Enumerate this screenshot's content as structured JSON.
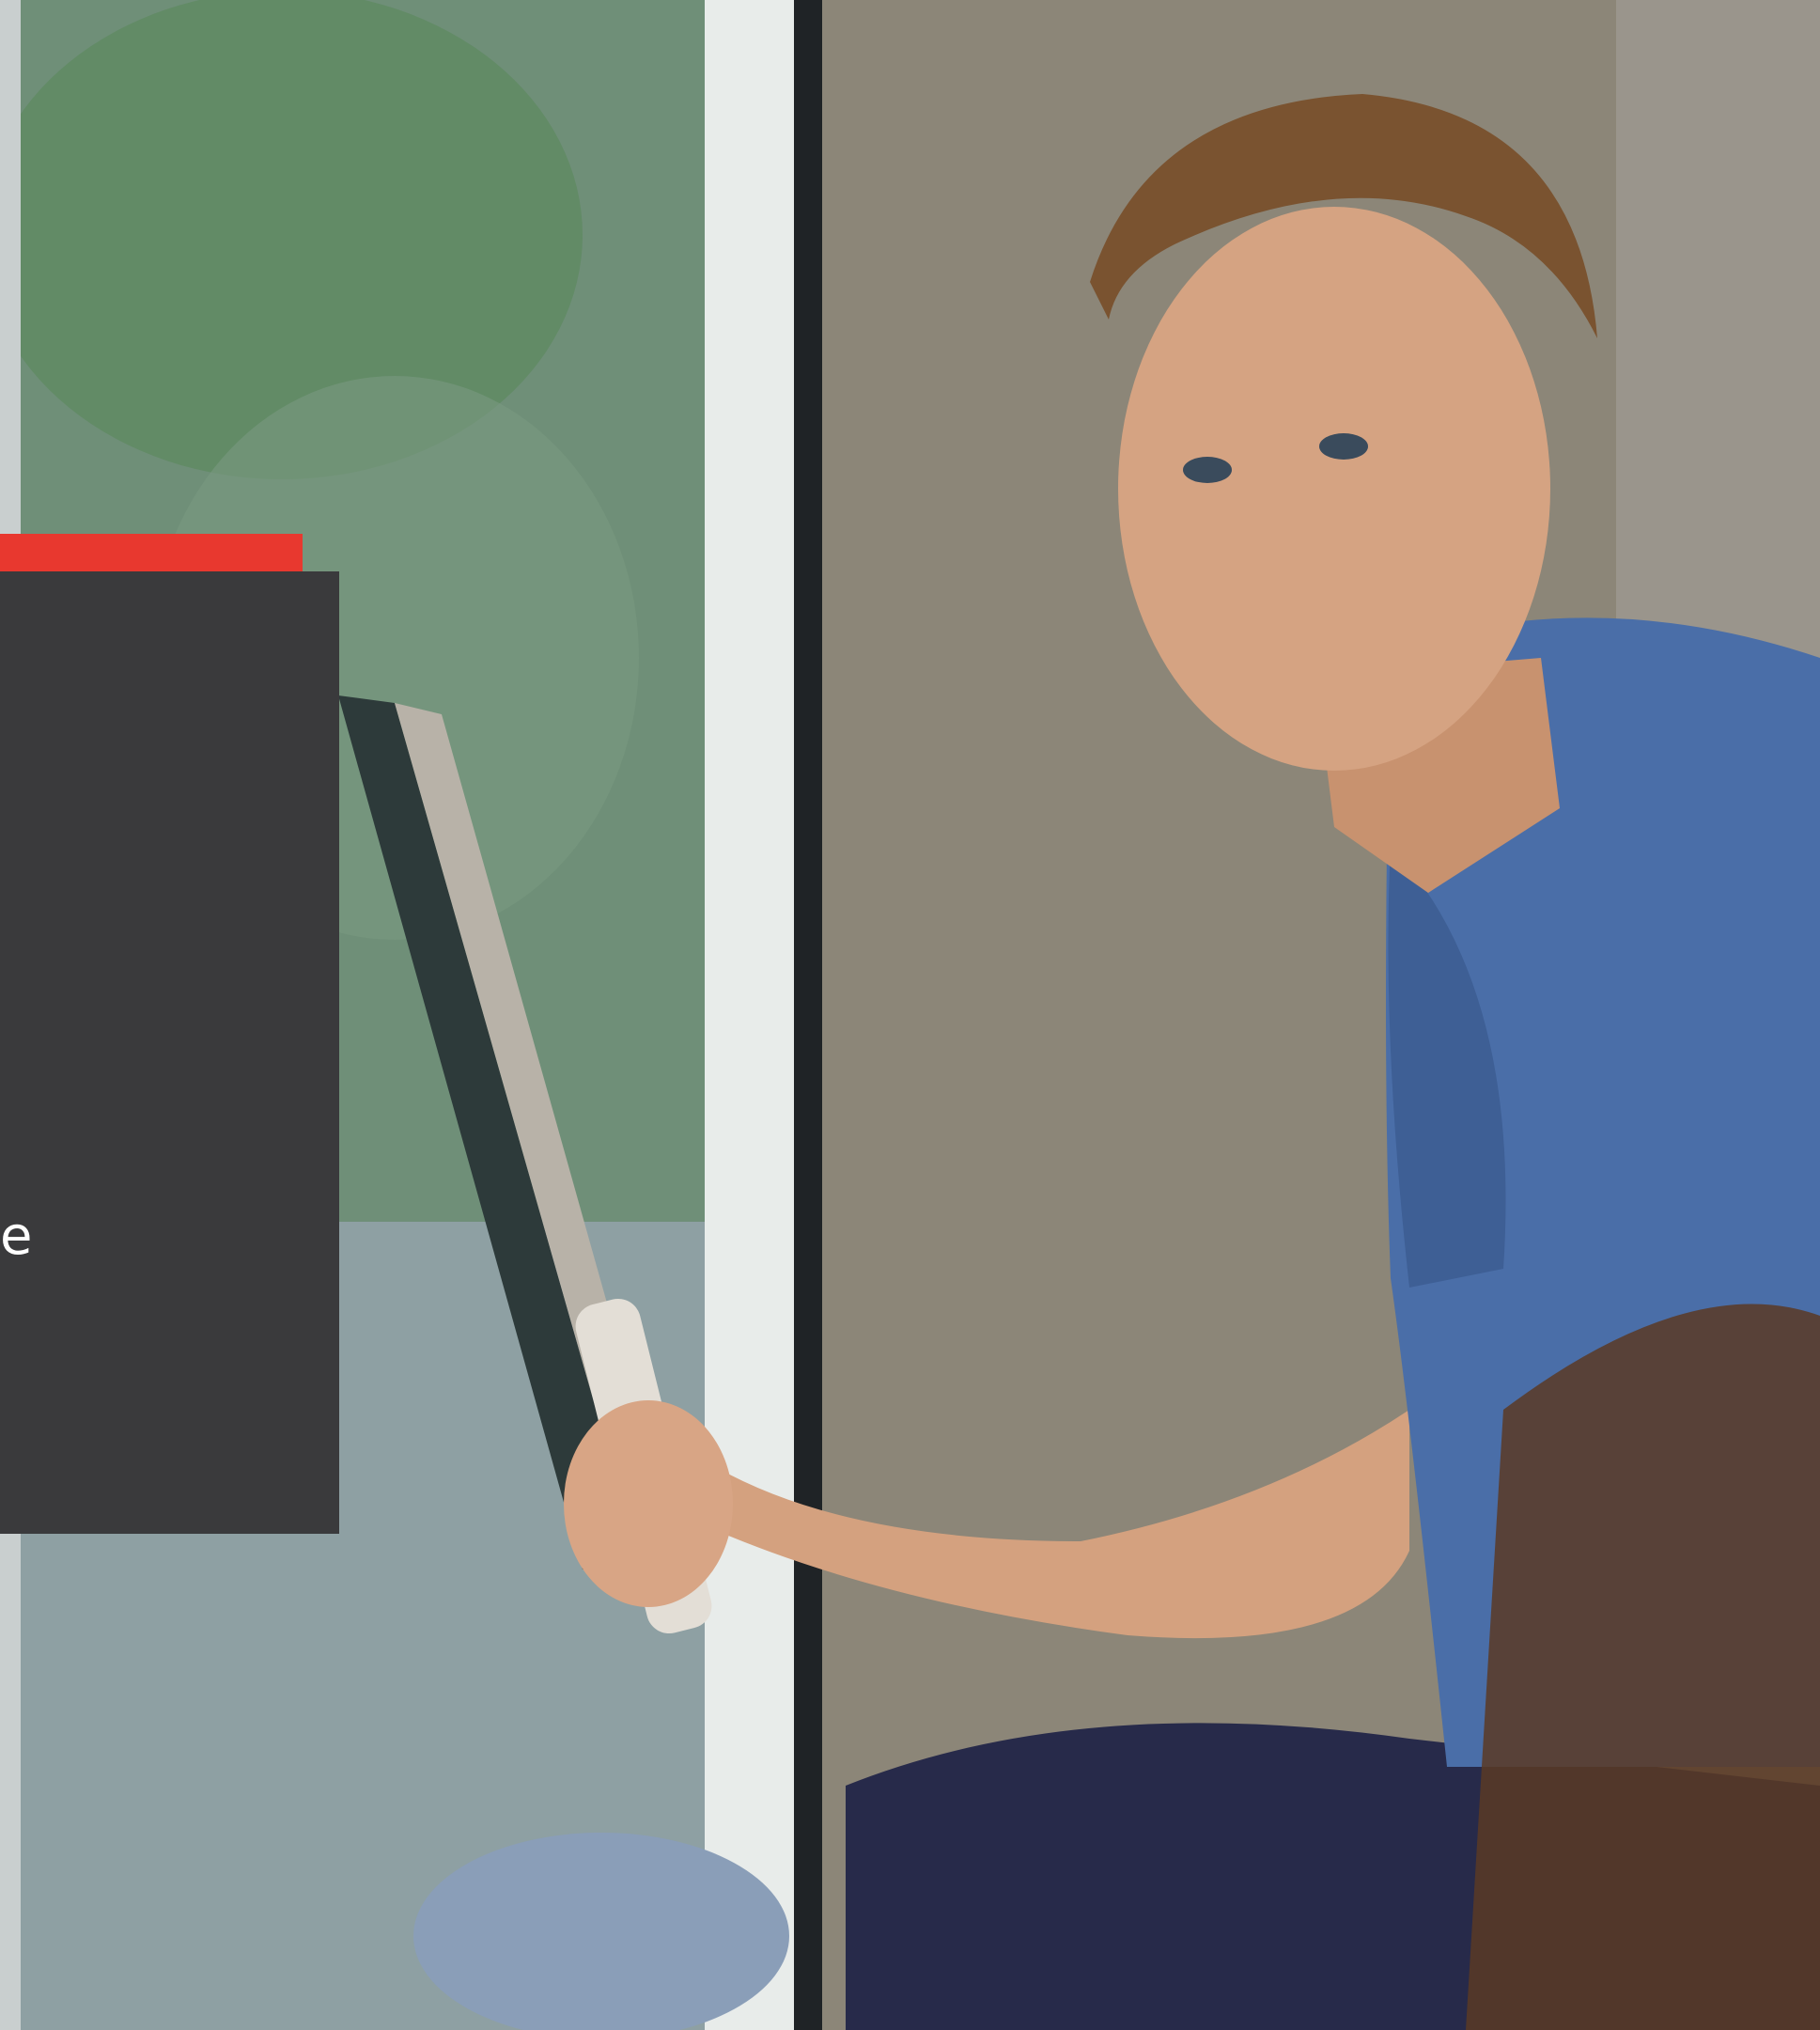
{
  "hero": {
    "description_icon": "photo-window-cleaner"
  },
  "overlay_card": {
    "visible_text": "e"
  },
  "colors": {
    "accent": "#e8382f",
    "card_background": "#3a3a3c",
    "text": "#ffffff"
  }
}
